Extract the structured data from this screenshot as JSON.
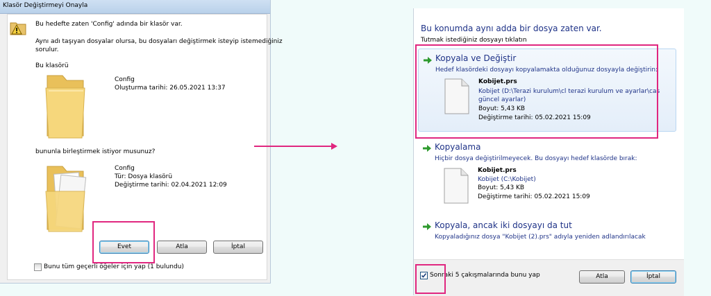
{
  "left_dialog": {
    "title": "Klasör Değiştirmeyi Onayla",
    "message_line1": "Bu hedefte zaten 'Config' adında bir klasör var.",
    "message_line2a": "Aynı adı taşıyan dosyalar olursa, bu dosyaları değiştirmek isteyip istemediğiniz",
    "message_line2b": "sorulur.",
    "this_folder_label": "Bu klasörü",
    "dest_folder": {
      "name": "Config",
      "created": "Oluşturma tarihi: 26.05.2021 13:37"
    },
    "merge_question": "bununla birleştirmek istiyor musunuz?",
    "source_folder": {
      "name": "Config",
      "type": "Tür: Dosya klasörü",
      "modified": "Değiştirme tarihi: 02.04.2021 12:09"
    },
    "buttons": {
      "yes": "Evet",
      "skip": "Atla",
      "cancel": "İptal"
    },
    "apply_all_label": "Bunu tüm geçerli öğeler için yap (1 bulundu)"
  },
  "right_dialog": {
    "header": "Bu konumda aynı adda bir dosya zaten var.",
    "subheader": "Tutmak istediğiniz dosyayı tıklatın",
    "options": [
      {
        "title": "Kopyala ve Değiştir",
        "desc": "Hedef klasördeki dosyayı kopyalamakta olduğunuz dosyayla değiştirin:",
        "file_name": "Kobijet.prs",
        "file_path_a": "Kobijet (D:\\Terazi kurulum\\cl terazi kurulum ve ayarlar\\cas",
        "file_path_b": "güncel ayarlar)",
        "size": "Boyut: 5,43 KB",
        "modified": "Değiştirme tarihi: 05.02.2021 15:09"
      },
      {
        "title": "Kopyalama",
        "desc": "Hiçbir dosya değiştirilmeyecek. Bu dosyayı hedef klasörde bırak:",
        "file_name": "Kobijet.prs",
        "file_path_a": "Kobijet (C:\\Kobijet)",
        "size": "Boyut: 5,43 KB",
        "modified": "Değiştirme tarihi: 05.02.2021 15:09"
      },
      {
        "title": "Kopyala, ancak iki dosyayı da tut",
        "desc": "Kopyaladığınız dosya \"Kobijet (2).prs\" adıyla yeniden adlandırılacak"
      }
    ],
    "next_conflicts_label": "Sonraki 5 çakışmalarında bunu yap",
    "buttons": {
      "skip": "Atla",
      "cancel": "İptal"
    }
  },
  "colors": {
    "highlight": "#e0267f",
    "link_blue": "#1e3287",
    "go_arrow": "#2e9a2e"
  }
}
